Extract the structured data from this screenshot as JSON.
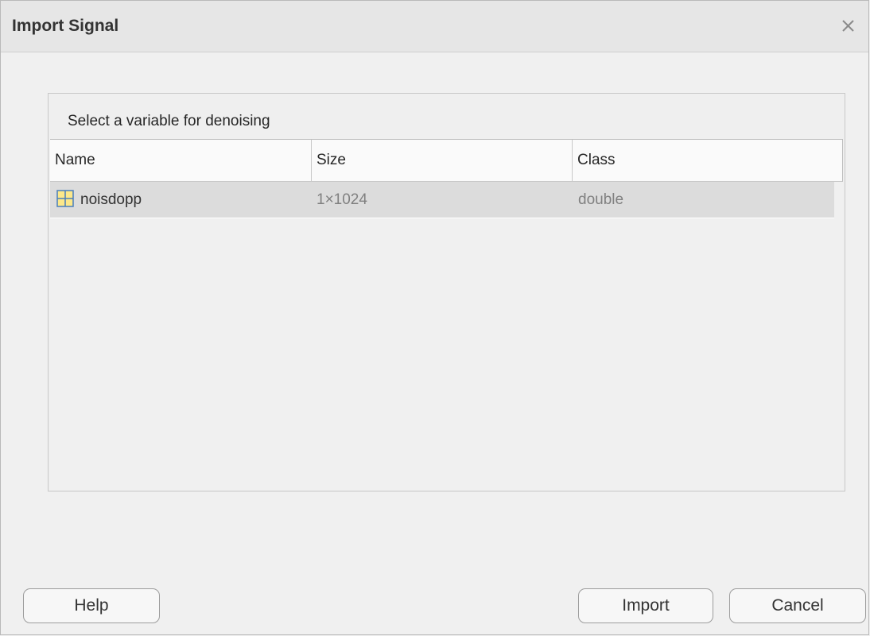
{
  "window": {
    "title": "Import Signal",
    "close_icon": "close-icon"
  },
  "panel": {
    "title": "Select a variable for denoising",
    "columns": [
      "Name",
      "Size",
      "Class"
    ],
    "rows": [
      {
        "name": "noisdopp",
        "size": "1×1024",
        "class": "double",
        "icon": "matrix-variable-icon",
        "selected": true
      }
    ]
  },
  "buttons": {
    "help": "Help",
    "import": "Import",
    "cancel": "Cancel"
  },
  "colors": {
    "selection": "#dcdcdc",
    "icon_grid": "#4a7ebb",
    "icon_fill": "#fce88a"
  }
}
